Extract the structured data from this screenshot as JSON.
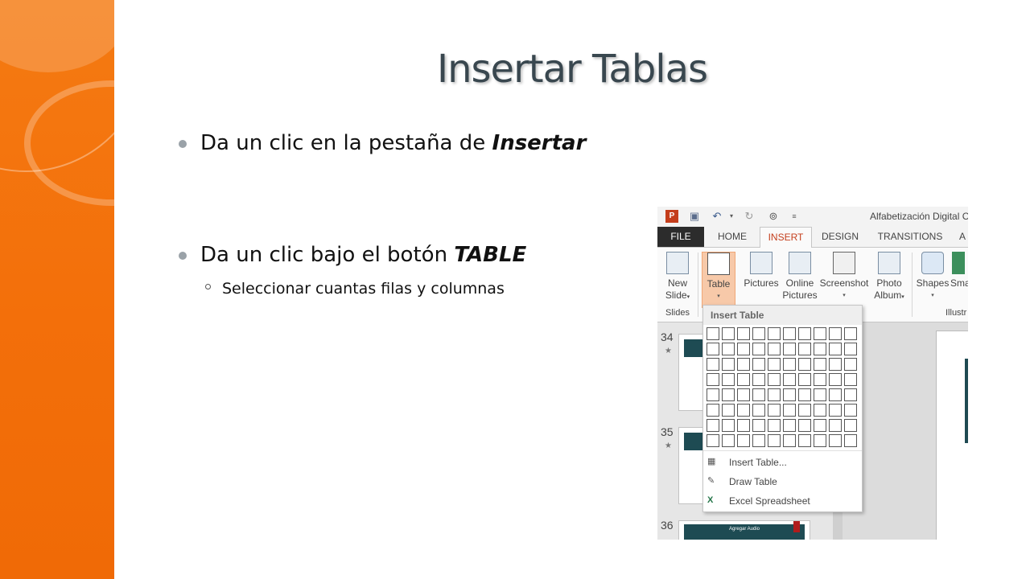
{
  "slide": {
    "title": "Insertar Tablas",
    "bullets": [
      {
        "prefix": "Da un clic en la pestaña de ",
        "emphasis": "Insertar"
      },
      {
        "prefix": "Da un clic bajo el botón ",
        "emphasis": "TABLE"
      }
    ],
    "sub_bullet": "Seleccionar cuantas filas y columnas"
  },
  "screenshot": {
    "window_title": "Alfabetización Digital C",
    "tabs": [
      {
        "label": "FILE"
      },
      {
        "label": "HOME"
      },
      {
        "label": "INSERT",
        "active": true
      },
      {
        "label": "DESIGN"
      },
      {
        "label": "TRANSITIONS"
      },
      {
        "label": "A"
      }
    ],
    "ribbon": {
      "new_slide": {
        "line1": "New",
        "line2": "Slide"
      },
      "table": {
        "line1": "Table"
      },
      "pictures": {
        "line1": "Pictures"
      },
      "online_pictures": {
        "line1": "Online",
        "line2": "Pictures"
      },
      "screenshot": {
        "line1": "Screenshot"
      },
      "photo_album": {
        "line1": "Photo",
        "line2": "Album"
      },
      "shapes": {
        "line1": "Shapes"
      },
      "smartart": {
        "line1": "Sma"
      },
      "groups": {
        "slides": "Slides",
        "illustrations": "Illustr"
      }
    },
    "slide_numbers": [
      "34",
      "35",
      "36"
    ],
    "thumb_36_text": "Agregar Audio",
    "insert_table": {
      "header": "Insert Table",
      "grid": {
        "cols": 10,
        "rows": 8
      },
      "items": [
        {
          "label": "Insert Table...",
          "icon": "table-grid-icon"
        },
        {
          "label": "Draw Table",
          "icon": "pencil-table-icon"
        },
        {
          "label": "Excel Spreadsheet",
          "icon": "excel-icon"
        }
      ]
    }
  },
  "colors": {
    "accent_orange": "#f47a12",
    "active_tab": "#c43e1c",
    "title_text": "#39474f"
  }
}
